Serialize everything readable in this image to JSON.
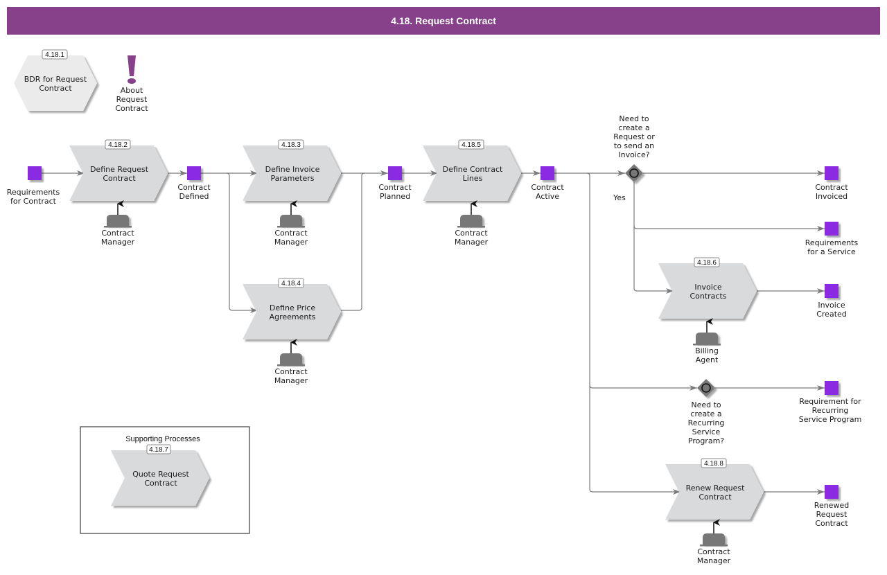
{
  "title": "4.18. Request Contract",
  "colors": {
    "title_bar": "#87418b",
    "event": "#8a2be2",
    "process": "#d9dadc",
    "role": "#777777",
    "gateway": "#777777",
    "info": "#87418b"
  },
  "overview": {
    "bdr": {
      "number": "4.18.1",
      "label_lines": [
        "BDR for Request",
        "Contract"
      ]
    },
    "about": {
      "icon": "exclamation-icon",
      "label_lines": [
        "About",
        "Request",
        "Contract"
      ]
    }
  },
  "processes": [
    {
      "id": "p2",
      "number": "4.18.2",
      "label_lines": [
        "Define Request",
        "Contract"
      ],
      "role_lines": [
        "Contract",
        "Manager"
      ]
    },
    {
      "id": "p3",
      "number": "4.18.3",
      "label_lines": [
        "Define Invoice",
        "Parameters"
      ],
      "role_lines": [
        "Contract",
        "Manager"
      ]
    },
    {
      "id": "p4",
      "number": "4.18.4",
      "label_lines": [
        "Define Price",
        "Agreements"
      ],
      "role_lines": [
        "Contract",
        "Manager"
      ]
    },
    {
      "id": "p5",
      "number": "4.18.5",
      "label_lines": [
        "Define Contract",
        "Lines"
      ],
      "role_lines": [
        "Contract",
        "Manager"
      ]
    },
    {
      "id": "p6",
      "number": "4.18.6",
      "label_lines": [
        "Invoice",
        "Contracts"
      ],
      "role_lines": [
        "Billing",
        "Agent"
      ]
    },
    {
      "id": "p8",
      "number": "4.18.8",
      "label_lines": [
        "Renew Request",
        "Contract"
      ],
      "role_lines": [
        "Contract",
        "Manager"
      ]
    }
  ],
  "events": [
    {
      "id": "e1",
      "label_lines": [
        "Requirements",
        "for Contract"
      ]
    },
    {
      "id": "e2",
      "label_lines": [
        "Contract",
        "Defined"
      ]
    },
    {
      "id": "e3",
      "label_lines": [
        "Contract",
        "Planned"
      ]
    },
    {
      "id": "e4",
      "label_lines": [
        "Contract",
        "Active"
      ]
    },
    {
      "id": "e5",
      "label_lines": [
        "Contract",
        "Invoiced"
      ]
    },
    {
      "id": "e6",
      "label_lines": [
        "Requirements",
        "for a Service"
      ]
    },
    {
      "id": "e7",
      "label_lines": [
        "Invoice",
        "Created"
      ]
    },
    {
      "id": "e8",
      "label_lines": [
        "Requirement for",
        "Recurring",
        "Service Program"
      ]
    },
    {
      "id": "e9",
      "label_lines": [
        "Renewed",
        "Request",
        "Contract"
      ]
    }
  ],
  "gateways": [
    {
      "id": "g1",
      "label_lines": [
        "Need to",
        "create a",
        "Request or",
        "to send an",
        "Invoice?"
      ],
      "branch_label": "Yes"
    },
    {
      "id": "g2",
      "label_lines": [
        "Need to",
        "create a",
        "Recurring",
        "Service",
        "Program?"
      ]
    }
  ],
  "supporting": {
    "title": "Supporting Processes",
    "process": {
      "number": "4.18.7",
      "label_lines": [
        "Quote Request",
        "Contract"
      ]
    }
  }
}
